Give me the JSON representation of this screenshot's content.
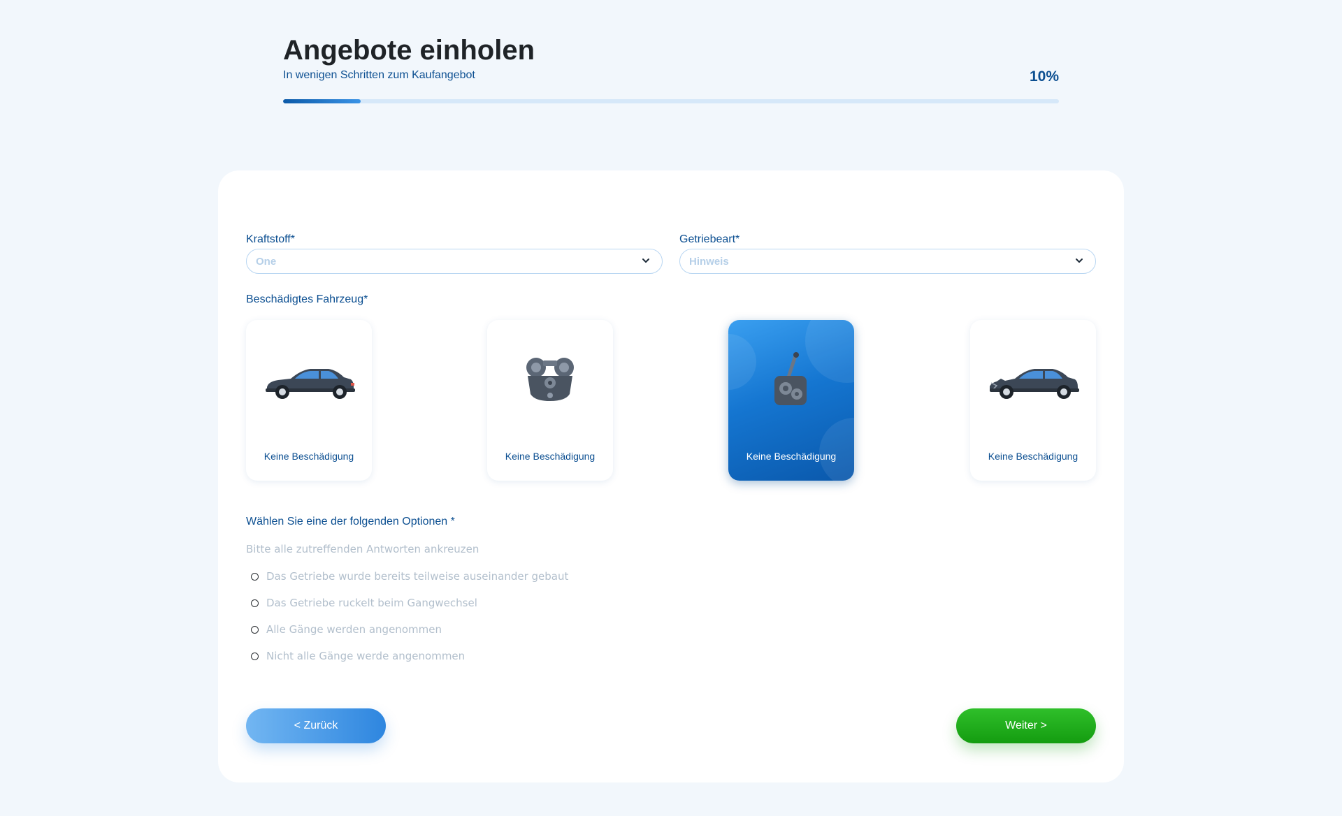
{
  "header": {
    "title": "Angebote einholen",
    "subtitle": "In wenigen Schritten zum Kaufangebot",
    "progress_label": "10%",
    "progress_value": 0.1
  },
  "form": {
    "fuel": {
      "label": "Kraftstoff*",
      "value": "One"
    },
    "gearbox": {
      "label": "Getriebeart*",
      "value": "Hinweis"
    },
    "damaged_vehicle": {
      "label": "Beschädigtes Fahrzeug*",
      "tiles": [
        {
          "label": "Keine Beschädigung",
          "icon": "car-icon",
          "selected": false
        },
        {
          "label": "Keine Beschädigung",
          "icon": "engine-icon",
          "selected": false
        },
        {
          "label": "Keine Beschädigung",
          "icon": "gearbox-icon",
          "selected": true
        },
        {
          "label": "Keine Beschädigung",
          "icon": "damaged-car-icon",
          "selected": false
        }
      ]
    },
    "options": {
      "title": "Wählen Sie eine der folgenden Optionen *",
      "hint": "Bitte alle zutreffenden Antworten ankreuzen",
      "items": [
        "Das Getriebe wurde bereits teilweise auseinander gebaut",
        "Das Getriebe ruckelt beim Gangwechsel",
        "Alle Gänge werden angenommen",
        "Nicht alle Gänge werde angenommen"
      ]
    }
  },
  "buttons": {
    "back": "< Zurück",
    "next": "Weiter >"
  },
  "colors": {
    "primary": "#0c4f91",
    "accent_blue": "#2e86df",
    "accent_green": "#149c10",
    "background": "#f2f7fc"
  }
}
